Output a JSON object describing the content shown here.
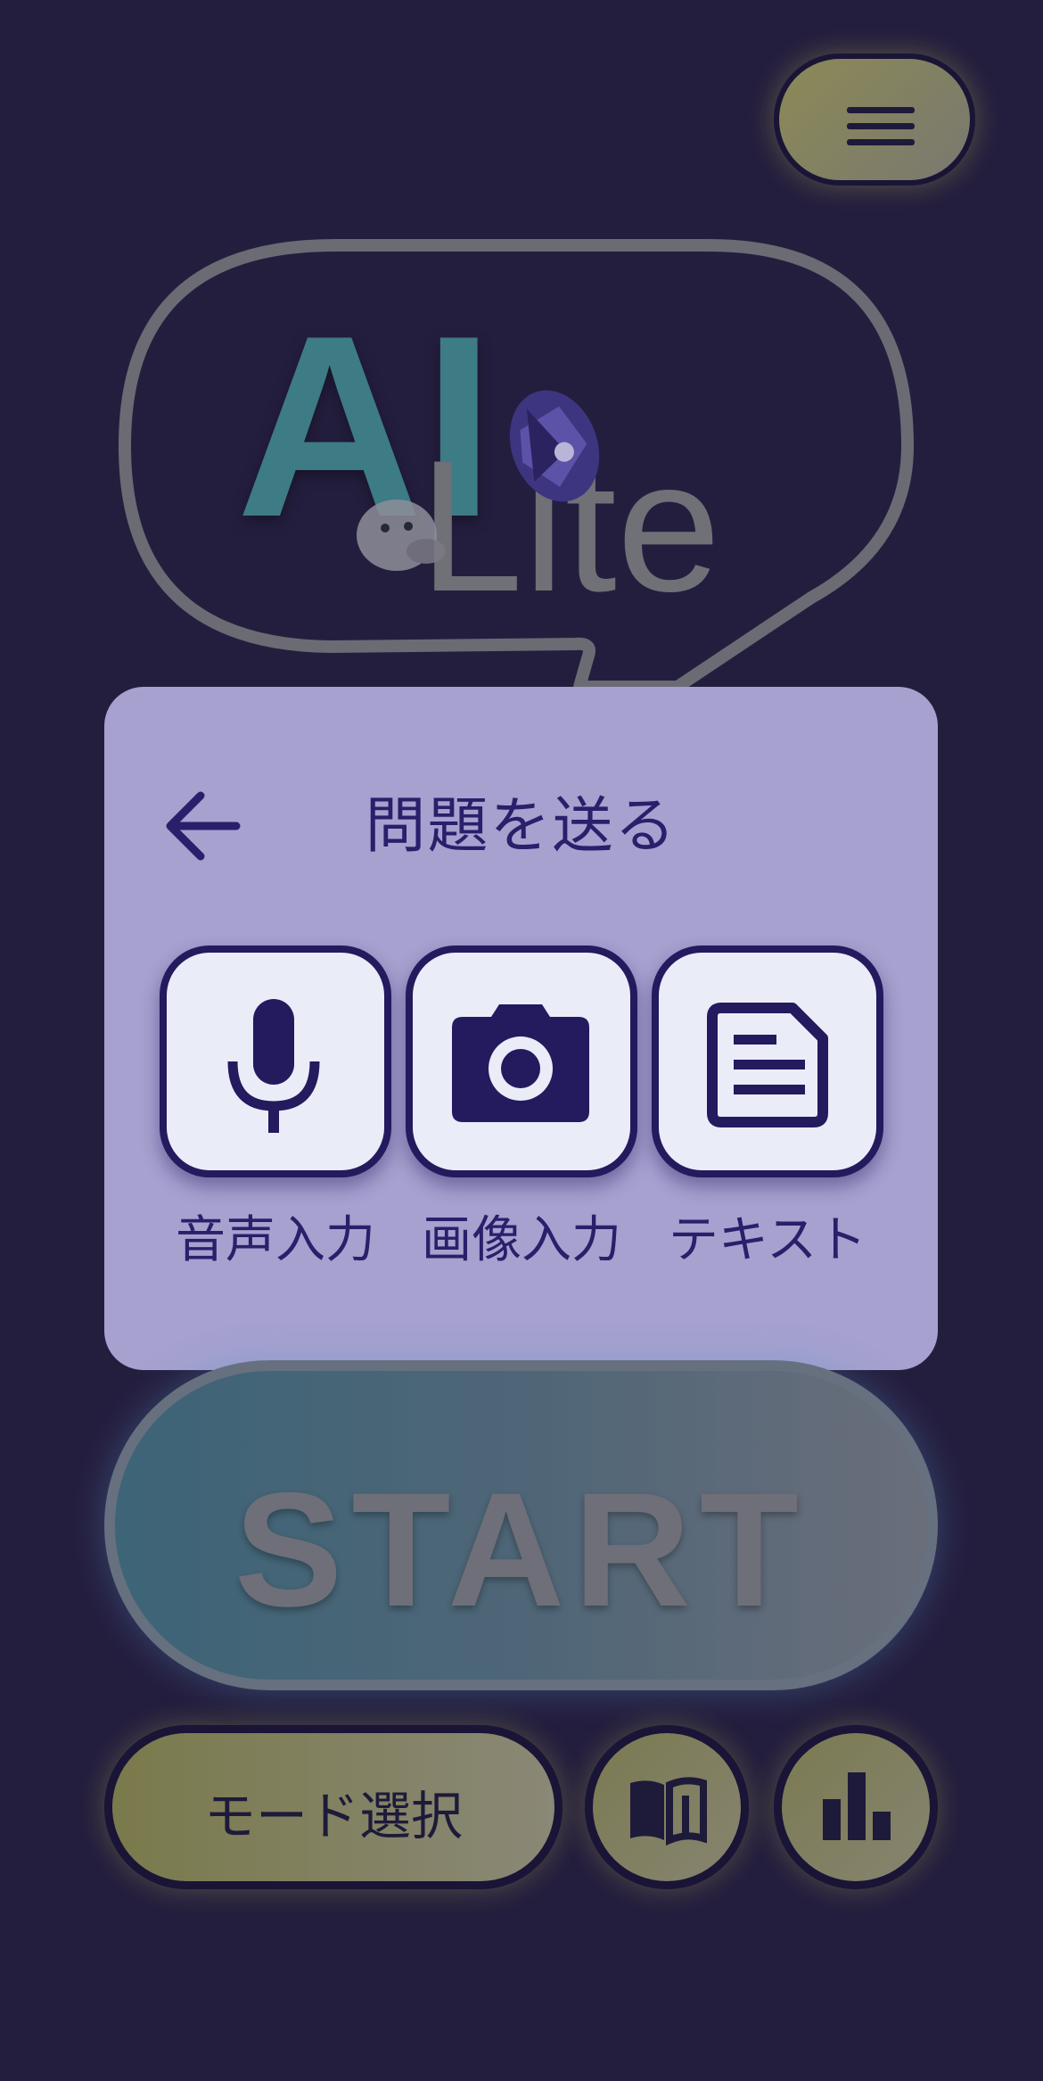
{
  "logo": {
    "text_ai": "AI",
    "text_lite": "Lite"
  },
  "menu": {
    "icon": "hamburger-menu-icon"
  },
  "modal": {
    "title": "問題を送る",
    "back_icon": "arrow-left-icon",
    "options": [
      {
        "label": "音声入力",
        "icon": "microphone-icon"
      },
      {
        "label": "画像入力",
        "icon": "camera-icon"
      },
      {
        "label": "テキスト",
        "icon": "document-icon"
      }
    ]
  },
  "start": {
    "label": "START"
  },
  "bottom": {
    "mode_label": "モード選択",
    "book_icon": "book-icon",
    "stats_icon": "bar-chart-icon"
  },
  "colors": {
    "background": "#241e3e",
    "modal": "#a6a1cf",
    "accent_dark": "#241a5e",
    "logo_ai": "#3d7b85"
  }
}
